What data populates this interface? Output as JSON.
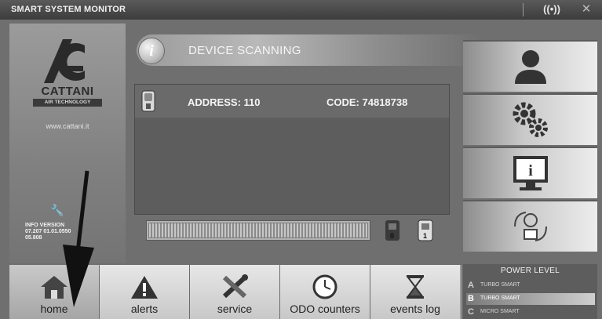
{
  "titlebar": {
    "title": "SMART SYSTEM MONITOR",
    "wifi_icon": "wifi-signal-icon",
    "close_icon": "close-icon"
  },
  "left_panel": {
    "brand": "CATTANI",
    "brand_sub": "AIR TECHNOLOGY",
    "website": "www.cattani.it",
    "info_version_title": "INFO VERSION",
    "info_version_line1": "07.207  01.01.0550",
    "info_version_line2": "05.808"
  },
  "scan": {
    "title": "DEVICE SCANNING"
  },
  "device": {
    "address": "ADDRESS: 110",
    "code": "CODE: 74818738"
  },
  "progress": {
    "fraction": 1.0
  },
  "device_counts": {
    "first": "0",
    "second": "1"
  },
  "right_buttons": [
    "user-icon",
    "settings-gears-icon",
    "info-monitor-icon",
    "network-search-icon"
  ],
  "nav": [
    {
      "label": "home",
      "icon": "home-icon"
    },
    {
      "label": "alerts",
      "icon": "warning-icon"
    },
    {
      "label": "service",
      "icon": "tools-icon"
    },
    {
      "label": "ODO counters",
      "icon": "clock-icon"
    },
    {
      "label": "events log",
      "icon": "hourglass-icon"
    }
  ],
  "power": {
    "title": "POWER LEVEL",
    "levels": [
      {
        "letter": "A",
        "name": "TURBO SMART"
      },
      {
        "letter": "B",
        "name": "TURBO SMART"
      },
      {
        "letter": "C",
        "name": "MICRO SMART"
      }
    ],
    "selected": "B"
  },
  "colors": {
    "accent": "#5d5d5d",
    "panel": "#6f6f6f"
  }
}
